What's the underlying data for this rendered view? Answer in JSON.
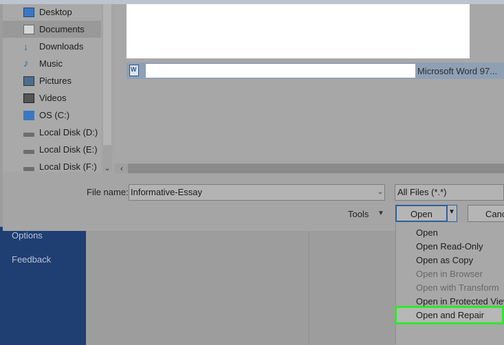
{
  "backstage": {
    "items": [
      {
        "label": "Options"
      },
      {
        "label": "Feedback"
      }
    ]
  },
  "nav": {
    "items": [
      {
        "label": "Desktop",
        "icon": "desktop-icon"
      },
      {
        "label": "Documents",
        "icon": "documents-icon",
        "selected": true
      },
      {
        "label": "Downloads",
        "icon": "downloads-icon"
      },
      {
        "label": "Music",
        "icon": "music-icon"
      },
      {
        "label": "Pictures",
        "icon": "pictures-icon"
      },
      {
        "label": "Videos",
        "icon": "videos-icon"
      },
      {
        "label": "OS (C:)",
        "icon": "os-drive-icon"
      },
      {
        "label": "Local Disk (D:)",
        "icon": "disk-icon"
      },
      {
        "label": "Local Disk (E:)",
        "icon": "disk-icon"
      },
      {
        "label": "Local Disk (F:)",
        "icon": "disk-icon"
      }
    ]
  },
  "files": {
    "selected_row": {
      "type": "Microsoft Word 97...",
      "icon_letter": "W"
    }
  },
  "bottom": {
    "file_name_label": "File name:",
    "file_name_value": "Informative-Essay",
    "file_type_value": "All Files (*.*)",
    "tools_label": "Tools",
    "open_label": "Open",
    "cancel_label": "Canc"
  },
  "open_menu": {
    "items": [
      {
        "label": "Open",
        "enabled": true
      },
      {
        "label": "Open Read-Only",
        "enabled": true
      },
      {
        "label": "Open as Copy",
        "enabled": true
      },
      {
        "label": "Open in Browser",
        "enabled": false
      },
      {
        "label": "Open with Transform",
        "enabled": false
      },
      {
        "label": "Open in Protected View",
        "enabled": true
      },
      {
        "label": "Open and Repair",
        "enabled": true,
        "highlighted": true
      }
    ]
  },
  "colors": {
    "backstage_nav": "#1f3e72",
    "highlight_border": "#2ee82a",
    "open_button_border": "#2e5e9c"
  }
}
